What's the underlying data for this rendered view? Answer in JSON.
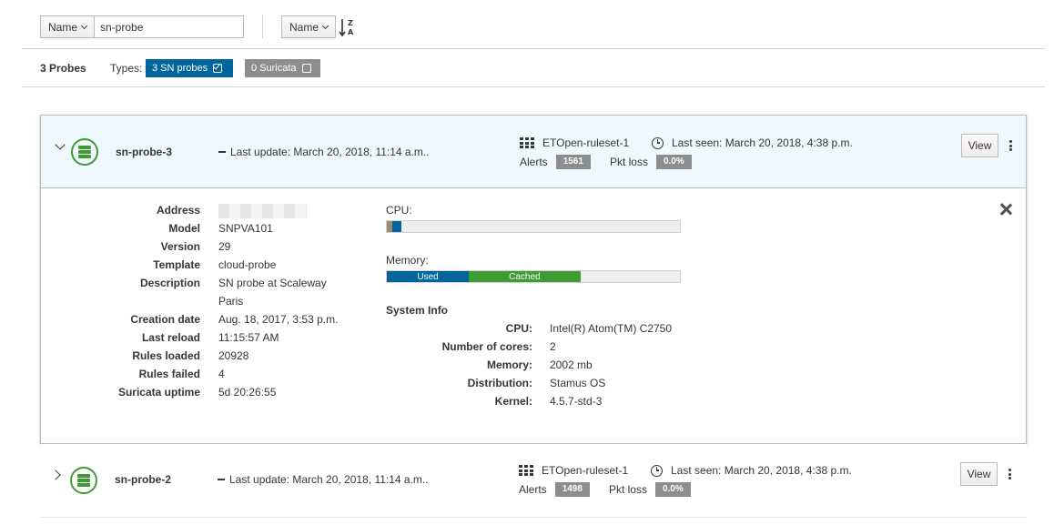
{
  "toolbar": {
    "filter_field": "Name",
    "filter_value": "sn-probe",
    "sort_field": "Name"
  },
  "summary": {
    "count_label": "3 Probes",
    "types_label": "Types:",
    "sn_probes_badge": "3 SN probes",
    "suricata_badge": "0 Suricata"
  },
  "probes": [
    {
      "name": "sn-probe-3",
      "last_update": "Last update: March 20, 2018, 11:14 a.m..",
      "ruleset": "ETOpen-ruleset-1",
      "last_seen": "Last seen: March 20, 2018, 4:38 p.m.",
      "alerts_label": "Alerts",
      "alerts": "1561",
      "pkt_loss_label": "Pkt loss",
      "pkt_loss": "0.0%",
      "view_label": "View",
      "expanded": true
    },
    {
      "name": "sn-probe-2",
      "last_update": "Last update: March 20, 2018, 11:14 a.m..",
      "ruleset": "ETOpen-ruleset-1",
      "last_seen": "Last seen: March 20, 2018, 4:38 p.m.",
      "alerts_label": "Alerts",
      "alerts": "1498",
      "pkt_loss_label": "Pkt loss",
      "pkt_loss": "0.0%",
      "view_label": "View",
      "expanded": false
    }
  ],
  "details": {
    "fields": [
      {
        "key": "Address",
        "value": ""
      },
      {
        "key": "Model",
        "value": "SNPVA101"
      },
      {
        "key": "Version",
        "value": "29"
      },
      {
        "key": "Template",
        "value": "cloud-probe"
      },
      {
        "key": "Description",
        "value": "SN probe at Scaleway"
      },
      {
        "key": "",
        "value": "Paris"
      },
      {
        "key": "Creation date",
        "value": "Aug. 18, 2017, 3:53 p.m."
      },
      {
        "key": "Last reload",
        "value": "11:15:57 AM"
      },
      {
        "key": "Rules loaded",
        "value": "20928"
      },
      {
        "key": "Rules failed",
        "value": "4"
      },
      {
        "key": "Suricata uptime",
        "value": "5d 20:26:55"
      }
    ],
    "cpu_label": "CPU:",
    "cpu_usage": {
      "user_pct": 2,
      "system_pct": 3,
      "user_color": "#9c8b6e",
      "system_color": "#00659c"
    },
    "memory_label": "Memory:",
    "memory_usage": {
      "used_label": "Used",
      "used_pct": 28,
      "used_color": "#00659c",
      "cached_label": "Cached",
      "cached_pct": 38,
      "cached_color": "#3f9c35"
    },
    "system_info_title": "System Info",
    "system_info": [
      {
        "key": "CPU:",
        "value": "Intel(R) Atom(TM) C2750"
      },
      {
        "key": "Number of cores:",
        "value": "2"
      },
      {
        "key": "Memory:",
        "value": "2002 mb"
      },
      {
        "key": "Distribution:",
        "value": "Stamus OS"
      },
      {
        "key": "Kernel:",
        "value": "4.5.7-std-3"
      }
    ]
  },
  "icons": {
    "probe": "server-icon",
    "ruleset": "grid-icon",
    "last_seen": "clock-icon",
    "sort": "sort-alpha-desc-icon",
    "close": "close-icon",
    "menu": "kebab-icon"
  },
  "colors": {
    "accent": "#00659c",
    "ok": "#3f9c35",
    "badge_gray": "#8b8d8f",
    "header_bg": "#eef8fd"
  }
}
